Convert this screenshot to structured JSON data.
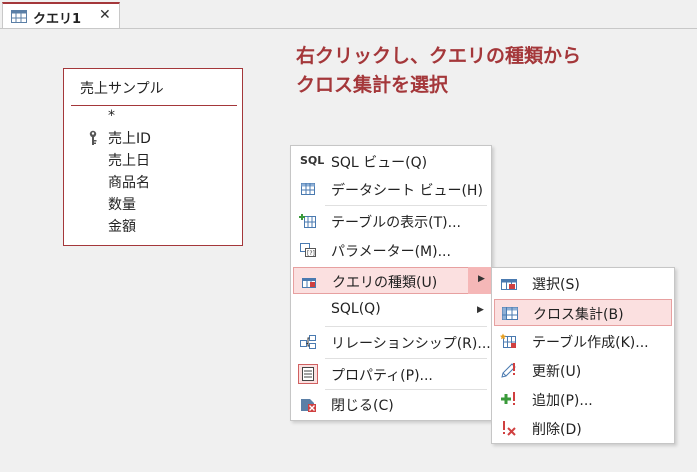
{
  "tab": {
    "label": "クエリ1",
    "close": "✕"
  },
  "instruction": {
    "line1": "右クリックし、クエリの種類から",
    "line2": "クロス集計を選択"
  },
  "table": {
    "title": "売上サンプル",
    "fields": [
      "*",
      "売上ID",
      "売上日",
      "商品名",
      "数量",
      "金額"
    ]
  },
  "context_menu": {
    "items": [
      {
        "label": "SQL ビュー(Q)",
        "icon": "sql-view-icon"
      },
      {
        "label": "データシート ビュー(H)",
        "icon": "datasheet-icon"
      },
      {
        "label": "テーブルの表示(T)...",
        "icon": "show-table-icon"
      },
      {
        "label": "パラメーター(M)...",
        "icon": "parameter-icon"
      },
      {
        "label": "クエリの種類(U)",
        "icon": "query-type-icon"
      },
      {
        "label": "SQL(Q)",
        "icon": ""
      },
      {
        "label": "リレーションシップ(R)...",
        "icon": "relationship-icon"
      },
      {
        "label": "プロパティ(P)...",
        "icon": "properties-icon"
      },
      {
        "label": "閉じる(C)",
        "icon": "close-icon"
      }
    ],
    "sql_icon_text": "SQL"
  },
  "submenu": {
    "items": [
      {
        "label": "選択(S)",
        "icon": "select-query-icon"
      },
      {
        "label": "クロス集計(B)",
        "icon": "crosstab-icon"
      },
      {
        "label": "テーブル作成(K)...",
        "icon": "make-table-icon"
      },
      {
        "label": "更新(U)",
        "icon": "update-query-icon"
      },
      {
        "label": "追加(P)...",
        "icon": "append-query-icon"
      },
      {
        "label": "削除(D)",
        "icon": "delete-query-icon"
      }
    ]
  },
  "colors": {
    "accent": "#a4373a",
    "highlight": "#fbe0e0",
    "highlight_border": "#e7a0a0"
  }
}
